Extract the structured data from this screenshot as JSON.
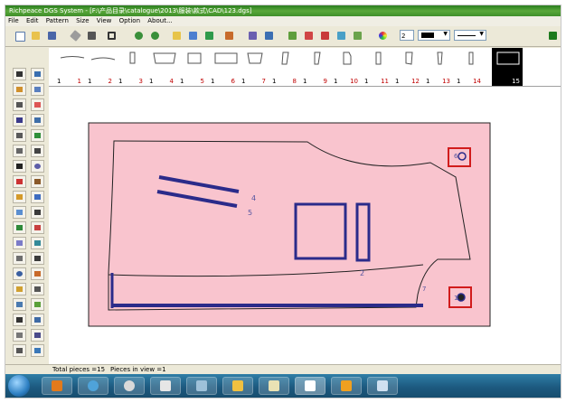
{
  "window": {
    "title": "Richpeace DGS System - [F:\\产品目录\\catalogue\\2013\\服装\\款式\\CAD\\123.dgs]"
  },
  "menu": [
    "File",
    "Edit",
    "Pattern",
    "Size",
    "View",
    "Option",
    "About..."
  ],
  "toolbar": {
    "line_width_value": "2"
  },
  "pieces": [
    {
      "count": "1",
      "index": "1"
    },
    {
      "count": "1",
      "index": "2"
    },
    {
      "count": "1",
      "index": "3"
    },
    {
      "count": "1",
      "index": "4"
    },
    {
      "count": "1",
      "index": "5"
    },
    {
      "count": "1",
      "index": "6"
    },
    {
      "count": "1",
      "index": "7"
    },
    {
      "count": "1",
      "index": "8"
    },
    {
      "count": "1",
      "index": "9"
    },
    {
      "count": "1",
      "index": "10"
    },
    {
      "count": "1",
      "index": "11"
    },
    {
      "count": "1",
      "index": "12"
    },
    {
      "count": "1",
      "index": "13"
    },
    {
      "count": "1",
      "index": "14"
    },
    {
      "count": "",
      "index": "15"
    }
  ],
  "canvas": {
    "labels": [
      "4",
      "5",
      "2",
      "6",
      "1",
      "7"
    ],
    "colors": {
      "piece_fill": "#f9c4ce",
      "outline": "#222222",
      "notch": "#2b2b8a",
      "marker": "#d11c1c"
    }
  },
  "status": {
    "total_pieces": "Total pieces =15",
    "pieces_in_view": "Pieces in view =1"
  },
  "taskbar": {
    "apps": [
      "media-player",
      "browser",
      "wheel",
      "game-controller",
      "drive",
      "folder",
      "notes",
      "cad-app",
      "volume",
      "window"
    ]
  }
}
